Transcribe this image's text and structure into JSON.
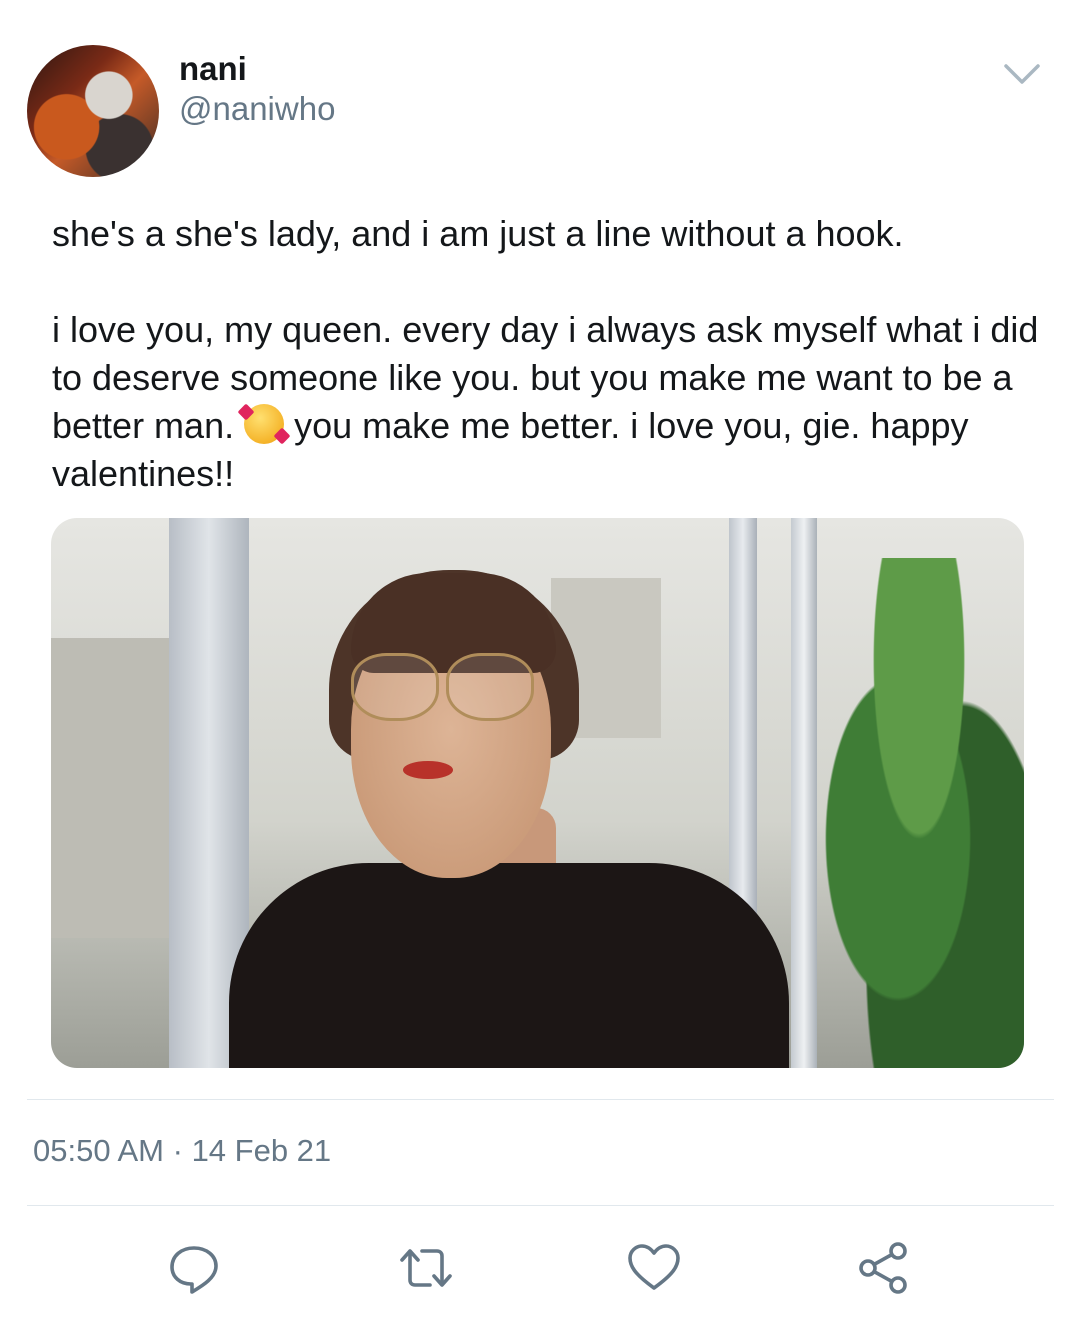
{
  "author": {
    "display_name": "nani",
    "handle": "@naniwho"
  },
  "tweet": {
    "paragraph_1": "she's a she's lady, and i am just a line without a hook.",
    "paragraph_2_part_1": "i love you, my queen. every day i always ask myself what i did to deserve someone like you. but you make me want to be a better man.",
    "emoji_icon": "smiling-face-with-hearts-icon",
    "paragraph_2_part_2": "you make me better. i love you, gie. happy valentines!!",
    "time": "05:50 AM",
    "date_separator": "·",
    "date": "14 Feb 21"
  },
  "actions": [
    {
      "name": "reply",
      "icon": "reply-icon"
    },
    {
      "name": "retweet",
      "icon": "retweet-icon"
    },
    {
      "name": "like",
      "icon": "heart-icon"
    },
    {
      "name": "share",
      "icon": "share-icon"
    }
  ],
  "colors": {
    "text": "#14171a",
    "secondary_text": "#657786",
    "divider": "#e1e8ed",
    "icon": "#657786"
  }
}
